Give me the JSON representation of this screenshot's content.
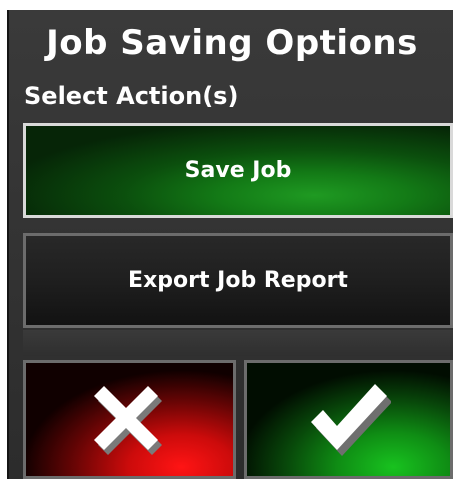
{
  "dialog": {
    "title": "Job Saving Options",
    "subtitle": "Select Action(s)",
    "options": [
      {
        "label": "Save Job",
        "selected": true
      },
      {
        "label": "Export Job Report",
        "selected": false
      }
    ],
    "actions": {
      "cancel_icon": "close-x-icon",
      "confirm_icon": "checkmark-icon"
    }
  },
  "colors": {
    "selected_option": "#137a16",
    "cancel": "#cc0b0b",
    "confirm": "#0f8d14",
    "background": "#333333",
    "text": "#ffffff"
  }
}
